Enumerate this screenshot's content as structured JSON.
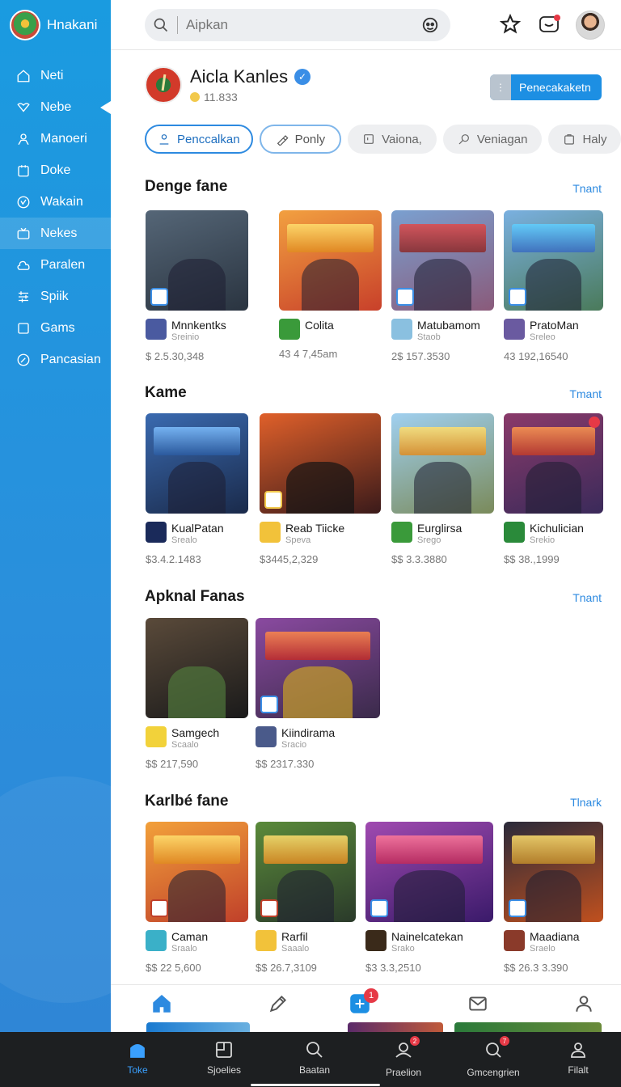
{
  "brand": {
    "name": "Hnakani"
  },
  "sidebar": {
    "items": [
      {
        "label": "Neti",
        "icon": "home-icon"
      },
      {
        "label": "Nebe",
        "icon": "heart-icon"
      },
      {
        "label": "Manoeri",
        "icon": "user-icon"
      },
      {
        "label": "Doke",
        "icon": "calendar-icon"
      },
      {
        "label": "Wakain",
        "icon": "clock-icon"
      },
      {
        "label": "Nekes",
        "icon": "box-icon"
      },
      {
        "label": "Paralen",
        "icon": "cloud-icon"
      },
      {
        "label": "Spiik",
        "icon": "layers-icon"
      },
      {
        "label": "Gams",
        "icon": "square-icon"
      },
      {
        "label": "Pancasian",
        "icon": "gauge-icon"
      }
    ]
  },
  "search": {
    "placeholder": "Aipkan"
  },
  "profile": {
    "name": "Aicla Kanles",
    "count": "11.833",
    "cta": "Penecakaketn"
  },
  "chips": [
    "Penccalkan",
    "Ponly",
    "Vaiona,",
    "Veniagan",
    "Haly"
  ],
  "sections": [
    {
      "title": "Denge fane",
      "see_all": "Tnant",
      "cards": [
        {
          "name": "Mnnkentks",
          "sub": "Sreinio",
          "price": "$ 2.5.30,348",
          "color": "#3d4a57"
        },
        {
          "name": "Colita",
          "sub": "",
          "price": "43 4 7,45am",
          "color": "#e0702a"
        },
        {
          "name": "Matubamom",
          "sub": "Staob",
          "price": "2$ 157.3530",
          "color": "#7a5a8a"
        },
        {
          "name": "PratoMan",
          "sub": "Sreleo",
          "price": "43 192,16540",
          "color": "#4a7ab0"
        }
      ]
    },
    {
      "title": "Kame",
      "see_all": "Tmant",
      "cards": [
        {
          "name": "KualPatan",
          "sub": "Srealo",
          "price": "$3.4.2.1483",
          "color": "#1e3a6a"
        },
        {
          "name": "Reab Tiicke",
          "sub": "Speva",
          "price": "$3445,2,329",
          "color": "#a0301e"
        },
        {
          "name": "Eurglirsa",
          "sub": "Srego",
          "price": "$$ 3.3.3880",
          "color": "#6aa0c8"
        },
        {
          "name": "Kichulician",
          "sub": "Srekio",
          "price": "$$ 38.,1999",
          "color": "#7a3a6a"
        }
      ]
    },
    {
      "title": "Apknal Fanas",
      "see_all": "Tnant",
      "cards": [
        {
          "name": "Samgech",
          "sub": "Scaalo",
          "price": "$$ 217,590",
          "color": "#3a3a2a"
        },
        {
          "name": "Kiindirama",
          "sub": "Sracio",
          "price": "$$ 2317.330",
          "color": "#5a3a8a"
        }
      ]
    },
    {
      "title": "Karlbé fane",
      "see_all": "Tlnark",
      "cards": [
        {
          "name": "Caman",
          "sub": "Sraalo",
          "price": "$$ 22 5,600",
          "color": "#e0701e"
        },
        {
          "name": "Rarfil",
          "sub": "Saaalo",
          "price": "$$ 26.7,3109",
          "color": "#3a6a3a"
        },
        {
          "name": "Nainelcatekan",
          "sub": "Srako",
          "price": "$3 3.3,2510",
          "color": "#5a2a8a"
        },
        {
          "name": "Maadiana",
          "sub": "Sraelo",
          "price": "$$ 26.3 3.390",
          "color": "#1a1a2a"
        }
      ]
    }
  ],
  "app_tabs": {
    "badge": "1"
  },
  "bottom_nav": [
    {
      "label": "Toke",
      "icon": "home-icon",
      "active": true
    },
    {
      "label": "Sjoelies",
      "icon": "grid-icon",
      "active": false
    },
    {
      "label": "Baatan",
      "icon": "search-icon",
      "active": false
    },
    {
      "label": "Praelion",
      "icon": "profile-icon",
      "active": false,
      "badge": "2"
    },
    {
      "label": "Gmcengrien",
      "icon": "search-badge-icon",
      "active": false,
      "badge": "7"
    },
    {
      "label": "Filalt",
      "icon": "person-icon",
      "active": false
    }
  ]
}
